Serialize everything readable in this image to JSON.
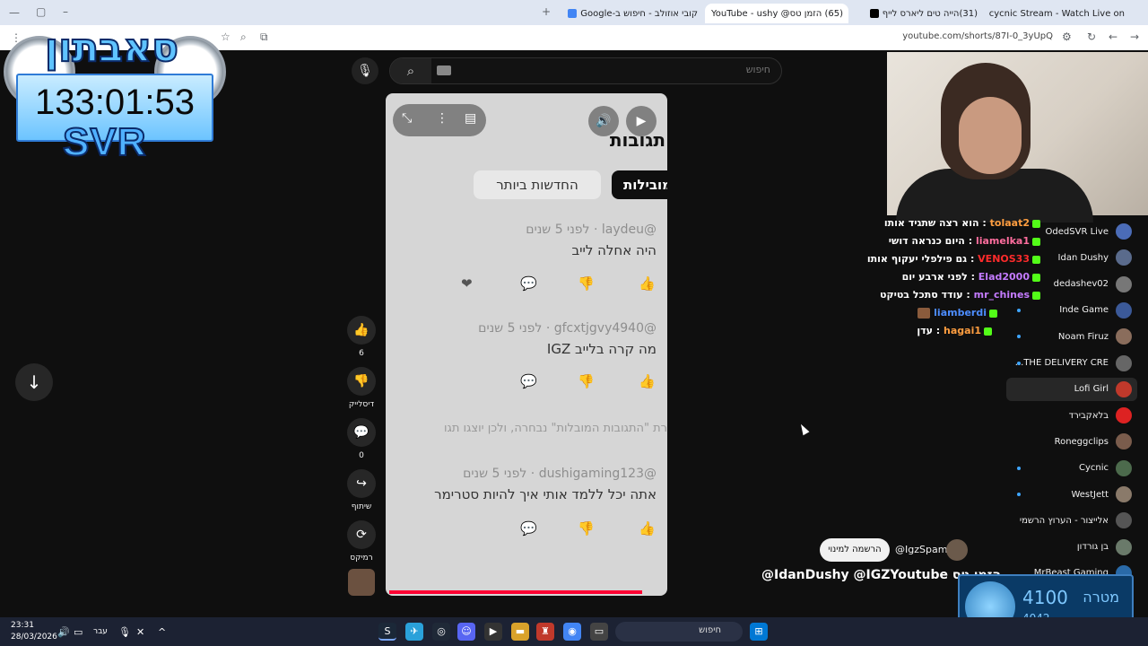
{
  "browser": {
    "tabs": [
      {
        "label": "cycnic Stream - Watch Live on",
        "color": "#53fc18"
      },
      {
        "label": "(31)הייה טים ליארס לייף",
        "color": "#000000"
      },
      {
        "label": "(65) הזמן טס@ YouTube - ushy",
        "color": "#ff0000"
      },
      {
        "label": "קובי אוזולב - חיפוש ב-Google",
        "color": "#4285f4"
      }
    ],
    "url": "youtube.com/shorts/87I-0_3yUpQ"
  },
  "overlay": {
    "logo": "סאבתון",
    "timer": "133:01:53",
    "brand": "SVR"
  },
  "youtube": {
    "search_placeholder": "חיפוש",
    "comments": {
      "heading": "תגובות",
      "tab_top": "מובילות",
      "tab_newest": "החדשות ביותר",
      "items": [
        {
          "author": "@laydeu",
          "time": "לפני 5 שנים",
          "text": "היה אחלה לייב"
        },
        {
          "author": "@gfcxtjgvy4940",
          "time": "לפני 5 שנים",
          "text": "מה קרה בלייב IGZ"
        },
        {
          "author": "@dushigaming123",
          "time": "לפני 5 שנים",
          "text": "אתה יכל ללמד אותי איך להיות סטרימר"
        }
      ],
      "notice": "רת \"התגובות המובלות\" נבחרה, ולכן יוצגו תגו"
    },
    "rail": {
      "likes": "6",
      "dislike_label": "דיסלייק",
      "comments_count": "0",
      "share_label": "שיתוף",
      "remix_label": "רמיקס"
    },
    "subscribe_button": "הרשמה למינוי",
    "channel_handle": "@IgzSpam"
  },
  "chat": [
    {
      "user": "tolaat2",
      "message": "הוא רצה שתגיד אותו",
      "color": "#ff9e40"
    },
    {
      "user": "liamelka1",
      "message": "היום כנראה דושי",
      "color": "#ff6e9e"
    },
    {
      "user": "VENOS33",
      "message": "גם פילפלי יעקוף אותו",
      "color": "#ff2b2b"
    },
    {
      "user": "Elad2000",
      "message": "לפני ארבע יום",
      "color": "#c47bff"
    },
    {
      "user": "mr_chines",
      "message": "עודד סתכל בטיקט",
      "color": "#c47bff"
    },
    {
      "user": "liamberdi",
      "message": "",
      "color": "#4d8dff"
    },
    {
      "user": "hagai1",
      "message": "עדן",
      "color": "#ff9e40"
    }
  ],
  "subscriptions": [
    "OdedSVR Live",
    "Idan Dushy",
    "dedashev02",
    "Inde Game",
    "Noam Firuz",
    "THE DELIVERY CRE...",
    "Lofi Girl",
    "בלאקבירד",
    "Roneggclips",
    "Cycnic",
    "WestJett",
    "אלייצור - הערוץ הרשמי",
    "בן גורדון",
    "MrBeast Gaming"
  ],
  "stream_banner": "@IdanDushy @IGZYoutube הזמן טס",
  "goal": {
    "label": "מטרה",
    "target": "4100",
    "current": "4042"
  },
  "taskbar": {
    "time": "23:31",
    "date": "28/03/2026",
    "lang": "עבר",
    "search": "חיפוש"
  }
}
